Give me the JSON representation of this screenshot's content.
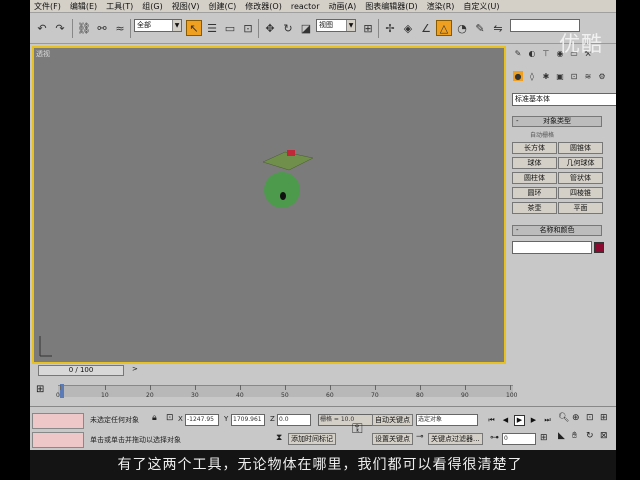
{
  "menu": [
    "文件(F)",
    "编辑(E)",
    "工具(T)",
    "组(G)",
    "视图(V)",
    "创建(C)",
    "修改器(O)",
    "reactor",
    "动画(A)",
    "图表编辑器(D)",
    "渲染(R)",
    "自定义(U)"
  ],
  "toolbar": {
    "selection_filter": "全部",
    "ref_coord": "视图"
  },
  "viewport": {
    "label": "透视"
  },
  "command_panel": {
    "category_dropdown": "标准基本体",
    "object_type_header": "对象类型",
    "autogrid_label": "自动栅格",
    "objects": [
      "长方体",
      "圆锥体",
      "球体",
      "几何球体",
      "圆柱体",
      "管状体",
      "圆环",
      "四棱锥",
      "茶壶",
      "平面"
    ],
    "name_color_header": "名称和颜色"
  },
  "time_slider": {
    "frame_label": "0 / 100"
  },
  "track_bar": {
    "ticks": [
      "0",
      "10",
      "20",
      "30",
      "40",
      "50",
      "60",
      "70",
      "80",
      "90",
      "100"
    ]
  },
  "status_bar": {
    "selection_status": "未选定任何对象",
    "prompt": "单击或单击并拖动以选择对象",
    "x_label": "X",
    "x_value": "-1247.95",
    "y_label": "Y",
    "y_value": "1709.961",
    "z_label": "Z",
    "z_value": "0.0",
    "grid": "栅格 = 10.0",
    "add_time_tag": "添加时间标记",
    "auto_key": "自动关键点",
    "selected_dropdown": "选定对象",
    "set_key": "设置关键点",
    "key_filters": "关键点过滤器...",
    "frame_value": "0"
  },
  "watermark": "优酷",
  "subtitle": "有了这两个工具，无论物体在哪里，我们都可以看得很清楚了",
  "colors": {
    "accent": "#f0a020",
    "viewport_bg": "#7b7b7b",
    "viewport_border": "#e8c020",
    "object_color": "#8b0a30"
  }
}
